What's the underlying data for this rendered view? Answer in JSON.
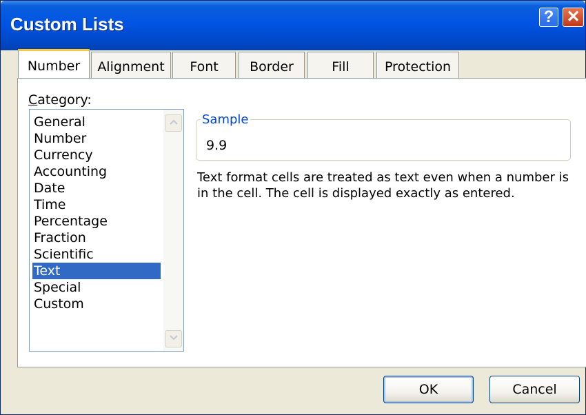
{
  "window": {
    "title": "Custom Lists",
    "help_glyph": "?",
    "close_glyph": "✕"
  },
  "tabs": [
    {
      "label": "Number",
      "active": true
    },
    {
      "label": "Alignment",
      "active": false
    },
    {
      "label": "Font",
      "active": false
    },
    {
      "label": "Border",
      "active": false
    },
    {
      "label": "Fill",
      "active": false
    },
    {
      "label": "Protection",
      "active": false
    }
  ],
  "category": {
    "label_first": "C",
    "label_rest": "ategory:",
    "items": [
      "General",
      "Number",
      "Currency",
      "Accounting",
      "Date",
      "Time",
      "Percentage",
      "Fraction",
      "Scientific",
      "Text",
      "Special",
      "Custom"
    ],
    "selected": "Text",
    "scroll_up_icon": "chevron-up-icon",
    "scroll_down_icon": "chevron-down-icon"
  },
  "sample": {
    "legend": "Sample",
    "value": "9.9"
  },
  "description": "Text format cells are treated as text even when a number is in the cell.  The cell is displayed exactly as entered.",
  "buttons": {
    "ok": "OK",
    "cancel": "Cancel"
  },
  "colors": {
    "titlebar": "#0054e3",
    "selection": "#316ac5",
    "active_tab_accent": "#ffc83c",
    "legend_text": "#0046d5"
  }
}
